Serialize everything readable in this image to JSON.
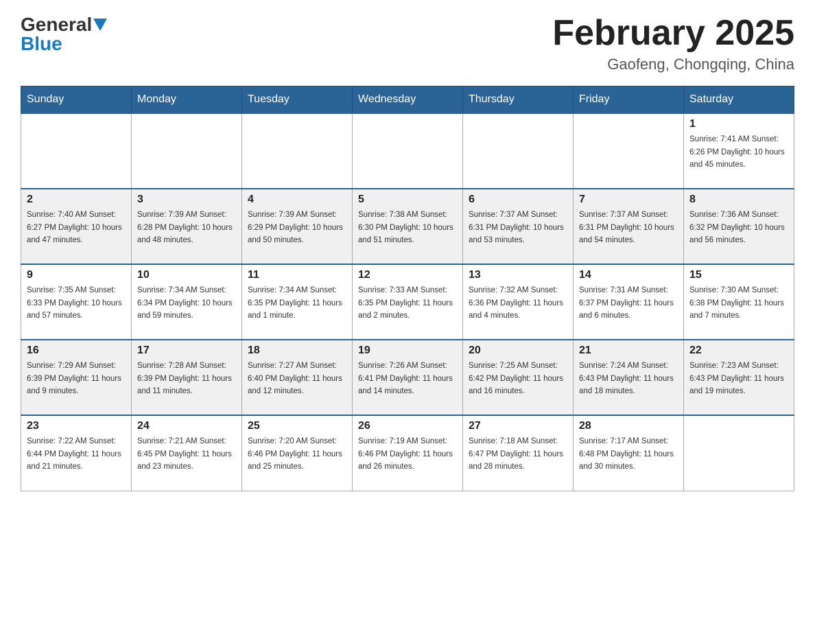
{
  "header": {
    "logo_general": "General",
    "logo_blue": "Blue",
    "month_title": "February 2025",
    "location": "Gaofeng, Chongqing, China"
  },
  "weekdays": [
    "Sunday",
    "Monday",
    "Tuesday",
    "Wednesday",
    "Thursday",
    "Friday",
    "Saturday"
  ],
  "weeks": [
    [
      {
        "day": "",
        "info": ""
      },
      {
        "day": "",
        "info": ""
      },
      {
        "day": "",
        "info": ""
      },
      {
        "day": "",
        "info": ""
      },
      {
        "day": "",
        "info": ""
      },
      {
        "day": "",
        "info": ""
      },
      {
        "day": "1",
        "info": "Sunrise: 7:41 AM\nSunset: 6:26 PM\nDaylight: 10 hours\nand 45 minutes."
      }
    ],
    [
      {
        "day": "2",
        "info": "Sunrise: 7:40 AM\nSunset: 6:27 PM\nDaylight: 10 hours\nand 47 minutes."
      },
      {
        "day": "3",
        "info": "Sunrise: 7:39 AM\nSunset: 6:28 PM\nDaylight: 10 hours\nand 48 minutes."
      },
      {
        "day": "4",
        "info": "Sunrise: 7:39 AM\nSunset: 6:29 PM\nDaylight: 10 hours\nand 50 minutes."
      },
      {
        "day": "5",
        "info": "Sunrise: 7:38 AM\nSunset: 6:30 PM\nDaylight: 10 hours\nand 51 minutes."
      },
      {
        "day": "6",
        "info": "Sunrise: 7:37 AM\nSunset: 6:31 PM\nDaylight: 10 hours\nand 53 minutes."
      },
      {
        "day": "7",
        "info": "Sunrise: 7:37 AM\nSunset: 6:31 PM\nDaylight: 10 hours\nand 54 minutes."
      },
      {
        "day": "8",
        "info": "Sunrise: 7:36 AM\nSunset: 6:32 PM\nDaylight: 10 hours\nand 56 minutes."
      }
    ],
    [
      {
        "day": "9",
        "info": "Sunrise: 7:35 AM\nSunset: 6:33 PM\nDaylight: 10 hours\nand 57 minutes."
      },
      {
        "day": "10",
        "info": "Sunrise: 7:34 AM\nSunset: 6:34 PM\nDaylight: 10 hours\nand 59 minutes."
      },
      {
        "day": "11",
        "info": "Sunrise: 7:34 AM\nSunset: 6:35 PM\nDaylight: 11 hours\nand 1 minute."
      },
      {
        "day": "12",
        "info": "Sunrise: 7:33 AM\nSunset: 6:35 PM\nDaylight: 11 hours\nand 2 minutes."
      },
      {
        "day": "13",
        "info": "Sunrise: 7:32 AM\nSunset: 6:36 PM\nDaylight: 11 hours\nand 4 minutes."
      },
      {
        "day": "14",
        "info": "Sunrise: 7:31 AM\nSunset: 6:37 PM\nDaylight: 11 hours\nand 6 minutes."
      },
      {
        "day": "15",
        "info": "Sunrise: 7:30 AM\nSunset: 6:38 PM\nDaylight: 11 hours\nand 7 minutes."
      }
    ],
    [
      {
        "day": "16",
        "info": "Sunrise: 7:29 AM\nSunset: 6:39 PM\nDaylight: 11 hours\nand 9 minutes."
      },
      {
        "day": "17",
        "info": "Sunrise: 7:28 AM\nSunset: 6:39 PM\nDaylight: 11 hours\nand 11 minutes."
      },
      {
        "day": "18",
        "info": "Sunrise: 7:27 AM\nSunset: 6:40 PM\nDaylight: 11 hours\nand 12 minutes."
      },
      {
        "day": "19",
        "info": "Sunrise: 7:26 AM\nSunset: 6:41 PM\nDaylight: 11 hours\nand 14 minutes."
      },
      {
        "day": "20",
        "info": "Sunrise: 7:25 AM\nSunset: 6:42 PM\nDaylight: 11 hours\nand 16 minutes."
      },
      {
        "day": "21",
        "info": "Sunrise: 7:24 AM\nSunset: 6:43 PM\nDaylight: 11 hours\nand 18 minutes."
      },
      {
        "day": "22",
        "info": "Sunrise: 7:23 AM\nSunset: 6:43 PM\nDaylight: 11 hours\nand 19 minutes."
      }
    ],
    [
      {
        "day": "23",
        "info": "Sunrise: 7:22 AM\nSunset: 6:44 PM\nDaylight: 11 hours\nand 21 minutes."
      },
      {
        "day": "24",
        "info": "Sunrise: 7:21 AM\nSunset: 6:45 PM\nDaylight: 11 hours\nand 23 minutes."
      },
      {
        "day": "25",
        "info": "Sunrise: 7:20 AM\nSunset: 6:46 PM\nDaylight: 11 hours\nand 25 minutes."
      },
      {
        "day": "26",
        "info": "Sunrise: 7:19 AM\nSunset: 6:46 PM\nDaylight: 11 hours\nand 26 minutes."
      },
      {
        "day": "27",
        "info": "Sunrise: 7:18 AM\nSunset: 6:47 PM\nDaylight: 11 hours\nand 28 minutes."
      },
      {
        "day": "28",
        "info": "Sunrise: 7:17 AM\nSunset: 6:48 PM\nDaylight: 11 hours\nand 30 minutes."
      },
      {
        "day": "",
        "info": ""
      }
    ]
  ]
}
